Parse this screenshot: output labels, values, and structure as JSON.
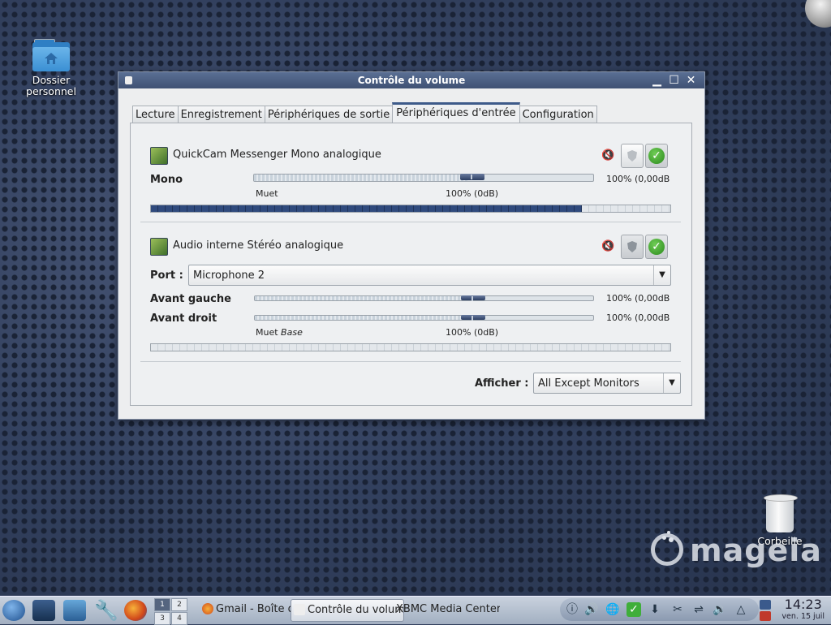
{
  "desktop": {
    "home_icon_label": "Dossier personnel",
    "trash_label": "Corbeille",
    "logo_text": "mageia"
  },
  "window": {
    "title": "Contrôle du volume",
    "tabs": [
      {
        "label": "Lecture"
      },
      {
        "label": "Enregistrement"
      },
      {
        "label": "Périphériques de sortie"
      },
      {
        "label": "Périphériques d'entrée"
      },
      {
        "label": "Configuration"
      }
    ],
    "active_tab": "Périphériques d'entrée"
  },
  "devices": [
    {
      "name": "QuickCam Messenger Mono analogique",
      "channels": [
        {
          "label": "Mono",
          "value_text": "100% (0,00dB",
          "level": 1.0
        }
      ],
      "scale_mute": "Muet",
      "scale_100": "100% (0dB)",
      "vu_level": 0.83
    },
    {
      "name": "Audio interne Stéréo analogique",
      "port_label": "Port :",
      "port_value": "Microphone 2",
      "channels": [
        {
          "label": "Avant gauche",
          "value_text": "100% (0,00dB",
          "level": 1.0
        },
        {
          "label": "Avant droit",
          "value_text": "100% (0,00dB",
          "level": 1.0
        }
      ],
      "scale_mute": "Muet",
      "scale_base": "Base",
      "scale_100": "100% (0dB)",
      "vu_level": 0.0
    }
  ],
  "footer": {
    "show_label": "Afficher :",
    "show_value": "All Except Monitors"
  },
  "taskbar": {
    "pager": [
      "1",
      "2",
      "3",
      "4"
    ],
    "tasks": [
      {
        "label": "Gmail - Boîte de"
      },
      {
        "label": "Contrôle du volume"
      },
      {
        "label": "XBMC Media Center"
      }
    ],
    "clock_time": "14:23",
    "clock_date": "ven. 15 juil"
  },
  "colors": {
    "accent": "#3d5a8a",
    "vu_fill": "#2f4a7d",
    "ok_green": "#2a8a1c"
  }
}
